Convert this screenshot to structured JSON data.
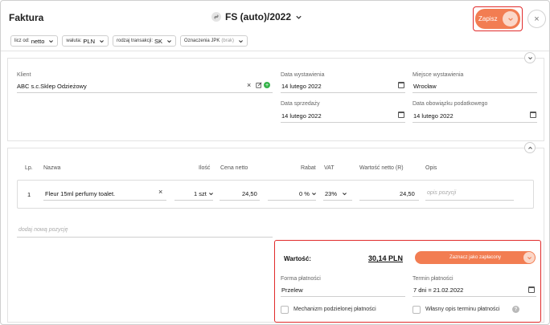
{
  "header": {
    "title": "Faktura",
    "document_number": "FS (auto)/2022",
    "save_label": "Zapisz",
    "close_glyph": "×"
  },
  "filters": [
    {
      "label": "licz od:",
      "value": "netto"
    },
    {
      "label": "waluta:",
      "value": "PLN"
    },
    {
      "label": "rodzaj transakcji:",
      "value": "SK"
    },
    {
      "label": "Oznaczenia JPK",
      "value": "(brak)"
    }
  ],
  "client": {
    "label": "Klient",
    "value": "ABC s.c.Sklep Odzieżowy"
  },
  "dates": {
    "issue_label": "Data wystawienia",
    "issue_value": "14 lutego 2022",
    "place_label": "Miejsce wystawienia",
    "place_value": "Wrocław",
    "sale_label": "Data sprzedaży",
    "sale_value": "14 lutego 2022",
    "tax_label": "Data obowiązku podatkowego",
    "tax_value": "14 lutego 2022"
  },
  "table": {
    "headers": {
      "lp": "Lp.",
      "name": "Nazwa",
      "qty": "Ilość",
      "net_price": "Cena netto",
      "discount": "Rabat",
      "vat": "VAT",
      "net_value": "Wartość netto (R)",
      "desc": "Opis"
    },
    "rows": [
      {
        "lp": "1",
        "name": "Fleur 15ml perfumy toalet.",
        "qty": "1 szt",
        "net_price": "24,50",
        "discount": "0 %",
        "vat": "23%",
        "net_value": "24,50",
        "desc_placeholder": "opis pozycji"
      }
    ],
    "add_position_placeholder": "dodaj nową pozycję"
  },
  "summary": {
    "total_label": "Wartość:",
    "total_value": "30,14 PLN",
    "mark_paid_label": "Zaznacz jako zapłacony",
    "payment_form_label": "Forma płatności",
    "payment_form_value": "Przelew",
    "payment_term_label": "Termin płatności",
    "payment_term_value": "7 dni = 21.02.2022",
    "split_payment_label": "Mechanizm podzielonej płatności",
    "own_term_label": "Własny opis terminu płatności",
    "help_glyph": "?"
  },
  "colors": {
    "accent": "#f27d52",
    "highlight": "#e12b2b",
    "add_icon": "#35b34a"
  }
}
